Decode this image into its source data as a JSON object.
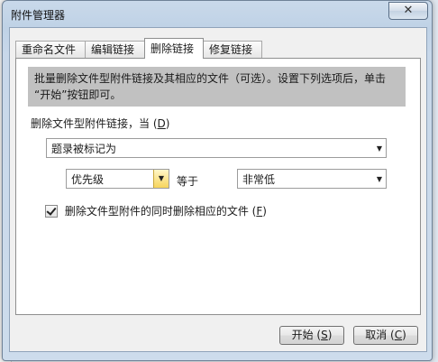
{
  "window": {
    "title": "附件管理器",
    "close_glyph": "✕"
  },
  "tabs": [
    {
      "label": "重命名文件"
    },
    {
      "label": "编辑链接"
    },
    {
      "label": "删除链接",
      "active": true
    },
    {
      "label": "修复链接"
    }
  ],
  "panel": {
    "info_line1": "批量删除文件型附件链接及其相应的文件（可选）。设置下列选项后，单击",
    "info_line2": "“开始”按钮即可。",
    "delete_when_label": "删除文件型附件链接，当",
    "delete_when_key": "D",
    "condition_select": {
      "value": "题录被标记为"
    },
    "field_select": {
      "value": "优先级"
    },
    "operator_label": "等于",
    "value_select": {
      "value": "非常低"
    },
    "delete_files_checkbox": {
      "checked": true,
      "label": "删除文件型附件的同时删除相应的文件",
      "key": "F"
    }
  },
  "buttons": {
    "start": {
      "label": "开始",
      "key": "S"
    },
    "cancel": {
      "label": "取消",
      "key": "C"
    }
  }
}
